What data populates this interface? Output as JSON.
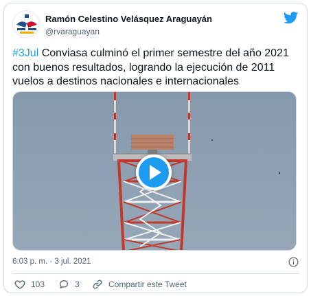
{
  "author": {
    "name": "Ramón Celestino Velásquez Araguayán",
    "handle": "@rvaraguayan",
    "avatar_icon": "org-logo-avatar"
  },
  "tweet": {
    "hashtag": "#3Jul",
    "text": " Conviasa culminó el primer semestre del año 2021 con buenos resultados, logrando la ejecución de 2011 vuelos a destinos nacionales e internacionales",
    "timestamp": "6:03 p. m. · 3 jul. 2021"
  },
  "media": {
    "type": "video",
    "play_icon": "play-icon"
  },
  "actions": {
    "like_count": "103",
    "reply_count": "3",
    "share_label": "Compartir este Tweet"
  },
  "colors": {
    "accent": "#1d9bf0",
    "text": "#0f1419",
    "secondary": "#536471",
    "border": "#cfd9de"
  }
}
